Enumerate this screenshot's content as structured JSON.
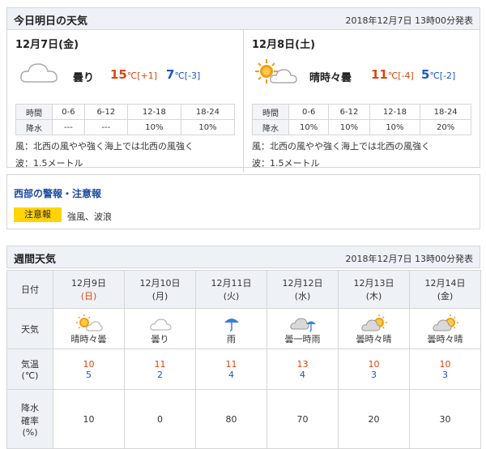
{
  "today_tomorrow": {
    "title": "今日明日の天気",
    "announced": "2018年12月7日 13時00分発表",
    "days": [
      {
        "date": "12月7日(金)",
        "weather": "曇り",
        "high": "15",
        "high_diff": "℃[+1]",
        "low": "7",
        "low_diff": "℃[-3]",
        "icon": "cloud-icon",
        "precip": {
          "time_label": "時間",
          "rain_label": "降水",
          "slots": [
            "0-6",
            "6-12",
            "12-18",
            "18-24"
          ],
          "values": [
            "---",
            "---",
            "10%",
            "10%"
          ]
        },
        "wind": "風：北西の風やや強く海上では北西の風強く",
        "wave": "波：1.5メートル"
      },
      {
        "date": "12月8日(土)",
        "weather": "晴時々曇",
        "high": "11",
        "high_diff": "℃[-4]",
        "low": "5",
        "low_diff": "℃[-2]",
        "icon": "sun-cloud-icon",
        "precip": {
          "time_label": "時間",
          "rain_label": "降水",
          "slots": [
            "0-6",
            "6-12",
            "12-18",
            "18-24"
          ],
          "values": [
            "10%",
            "10%",
            "10%",
            "20%"
          ]
        },
        "wind": "風：北西の風やや強く海上では北西の風強く",
        "wave": "波：1.5メートル"
      }
    ]
  },
  "warnings": {
    "title": "西部の警報・注意報",
    "badge": "注意報",
    "text": "強風、波浪"
  },
  "weekly": {
    "title": "週間天気",
    "announced": "2018年12月7日 13時00分発表",
    "labels": {
      "date": "日付",
      "weather": "天気",
      "temp": "気温\n(℃)",
      "rain": "降水\n確率\n(%)"
    },
    "days": [
      {
        "date": "12月9日",
        "dow": "(日)",
        "weather": "晴時々曇",
        "icon": "sun-cloud-icon",
        "high": "10",
        "low": "5",
        "rain": "10"
      },
      {
        "date": "12月10日",
        "dow": "(月)",
        "weather": "曇り",
        "icon": "cloud-icon",
        "high": "11",
        "low": "2",
        "rain": "0"
      },
      {
        "date": "12月11日",
        "dow": "(火)",
        "weather": "雨",
        "icon": "umbrella-icon",
        "high": "11",
        "low": "4",
        "rain": "80"
      },
      {
        "date": "12月12日",
        "dow": "(水)",
        "weather": "曇一時雨",
        "icon": "cloud-umbrella-icon",
        "high": "13",
        "low": "4",
        "rain": "70"
      },
      {
        "date": "12月13日",
        "dow": "(木)",
        "weather": "曇時々晴",
        "icon": "cloud-sun-icon",
        "high": "10",
        "low": "3",
        "rain": "20"
      },
      {
        "date": "12月14日",
        "dow": "(金)",
        "weather": "曇時々晴",
        "icon": "cloud-sun-icon",
        "high": "10",
        "low": "3",
        "rain": "30"
      }
    ]
  },
  "colors": {
    "high": "#d9480f",
    "low": "#1c55c4",
    "sunday": "#d9480f",
    "header_bg": "#eef1f6",
    "badge": "#ffd400"
  }
}
